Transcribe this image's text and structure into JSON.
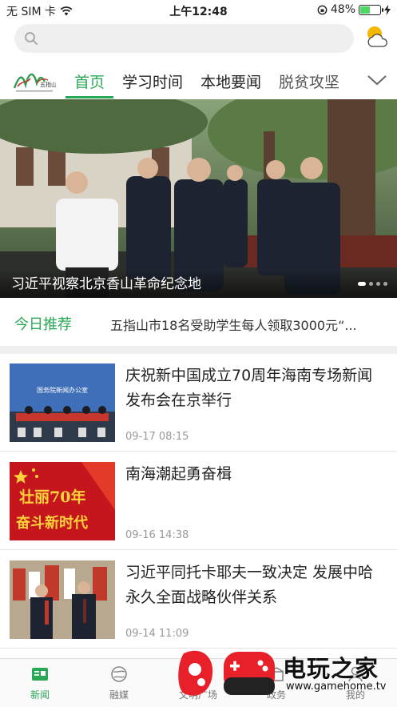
{
  "status_bar": {
    "carrier": "无 SIM 卡",
    "time": "上午12:48",
    "battery": "48%",
    "battery_level": 0.48
  },
  "search": {
    "placeholder": ""
  },
  "channels": {
    "tabs": [
      "首页",
      "学习时间",
      "本地要闻",
      "脱贫攻坚"
    ],
    "active_index": 0
  },
  "hero": {
    "caption": "习近平视察北京香山革命纪念地",
    "slide_count": 4,
    "active_slide": 0
  },
  "recommend": {
    "label": "今日推荐",
    "text": "五指山市18名受助学生每人领取3000元“..."
  },
  "news": [
    {
      "title": "庆祝新中国成立70周年海南专场新闻发布会在京举行",
      "date": "09-17 08:15",
      "thumb_text": "国务院新闻办公室"
    },
    {
      "title": "南海潮起勇奋楫",
      "date": "09-16 14:38",
      "thumb_line1": "壮丽70年",
      "thumb_line2": "奋斗新时代"
    },
    {
      "title": "习近平同托卡耶夫一致决定 发展中哈永久全面战略伙伴关系",
      "date": "09-14 11:09"
    }
  ],
  "bottom_nav": {
    "items": [
      "新闻",
      "融媒",
      "文明广场",
      "政务",
      "我的"
    ],
    "active_index": 0
  },
  "watermark": {
    "brand": "电玩之家",
    "url": "www.gamehome.tv"
  },
  "colors": {
    "accent": "#2aa857"
  }
}
